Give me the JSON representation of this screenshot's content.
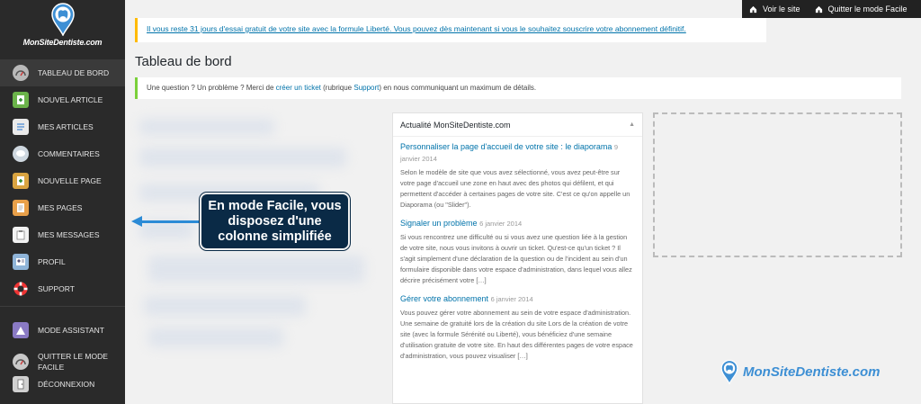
{
  "sidebar": {
    "logo_text": "MonSiteDentiste.com",
    "items": [
      {
        "label": "TABLEAU DE BORD",
        "icon": "dashboard-icon"
      },
      {
        "label": "NOUVEL ARTICLE",
        "icon": "new-article-icon"
      },
      {
        "label": "MES ARTICLES",
        "icon": "articles-icon"
      },
      {
        "label": "COMMENTAIRES",
        "icon": "comments-icon"
      },
      {
        "label": "NOUVELLE PAGE",
        "icon": "new-page-icon"
      },
      {
        "label": "MES PAGES",
        "icon": "pages-icon"
      },
      {
        "label": "MES MESSAGES",
        "icon": "messages-icon"
      },
      {
        "label": "PROFIL",
        "icon": "profile-icon"
      },
      {
        "label": "SUPPORT",
        "icon": "support-lifebuoy-icon"
      },
      {
        "label": "MODE ASSISTANT",
        "icon": "assistant-mode-icon"
      },
      {
        "label": "QUITTER LE MODE FACILE",
        "icon": "quit-easy-mode-icon"
      },
      {
        "label": "DÉCONNEXION",
        "icon": "logout-icon"
      }
    ]
  },
  "topbar": {
    "view_site": "Voir le site",
    "quit_easy": "Quitter le mode Facile"
  },
  "notice_trial": "Il vous reste 31 jours d'essai gratuit de votre site avec la formule Liberté. Vous pouvez dès maintenant si vous le souhaitez souscrire votre abonnement définitif.",
  "page_title": "Tableau de bord",
  "notice_help": {
    "before": "Une question ? Un problème ? Merci de ",
    "link1": "créer un ticket",
    "middle": " (rubrique ",
    "link2": "Support",
    "after": ") en nous communiquant un maximum de détails."
  },
  "callout": {
    "line1": "En mode Facile, vous",
    "line2": "disposez d'une",
    "line3": "colonne simplifiée"
  },
  "news": {
    "title": "Actualité MonSiteDentiste.com",
    "items": [
      {
        "title": "Personnaliser la page d'accueil de votre site : le diaporama",
        "date": "9 janvier 2014",
        "text": "Selon le modèle de site que vous avez sélectionné, vous avez peut-être sur votre page d'accueil une zone en haut avec des photos qui défilent, et qui permettent d'accéder à certaines pages de votre site. C'est ce qu'on appelle un Diaporama (ou \"Slider\")."
      },
      {
        "title": "Signaler un problème",
        "date": "6 janvier 2014",
        "text": "Si vous rencontrez une difficulté ou si vous avez une question liée à la gestion de votre site, nous vous invitons à ouvrir un ticket. Qu'est-ce qu'un ticket ? Il s'agit simplement d'une déclaration de la question ou de l'incident au sein d'un formulaire disponible dans votre espace d'administration, dans lequel vous allez décrire précisément votre […]"
      },
      {
        "title": "Gérer votre abonnement",
        "date": "6 janvier 2014",
        "text": "Vous pouvez gérer votre abonnement au sein de votre espace d'administration. Une semaine de gratuité lors de la création du site Lors de la création de votre site (avec la formule Sérénité ou Liberté), vous bénéficiez d'une semaine d'utilisation gratuite de votre site. En haut des différentes pages de votre espace d'administration, vous pouvez visualiser […]"
      }
    ]
  },
  "watermark": "MonSiteDentiste.com",
  "colors": {
    "sidebar_bg": "#2a2a2a",
    "link": "#0073aa",
    "notice_warning": "#ffba00",
    "notice_success": "#7ad03a",
    "callout_bg": "#0a2a46",
    "arrow": "#2c8bd6",
    "brand": "#3d8fd4"
  }
}
